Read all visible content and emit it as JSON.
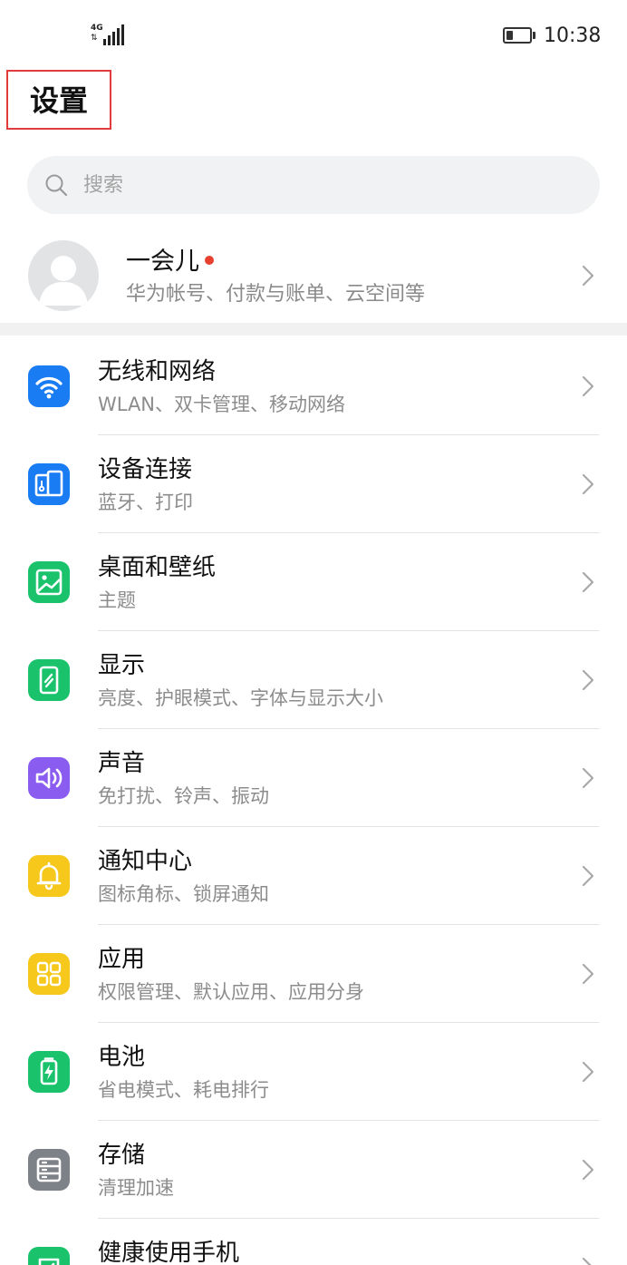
{
  "status_bar": {
    "network": "4G",
    "time": "10:38",
    "battery_level": 0.3
  },
  "header": {
    "title": "设置"
  },
  "search": {
    "placeholder": "搜索",
    "value": ""
  },
  "account": {
    "name": "一会儿",
    "subtitle": "华为帐号、付款与账单、云空间等",
    "has_notification": true
  },
  "colors": {
    "highlight_border": "#e33b3b",
    "notification_dot": "#e8402f",
    "blue": "#1a7cf2",
    "green": "#19c26b",
    "purple": "#8a5cf0",
    "yellow": "#f6c81c",
    "gray": "#7d8188"
  },
  "menu": {
    "items": [
      {
        "title": "无线和网络",
        "subtitle": "WLAN、双卡管理、移动网络",
        "icon": "wifi-icon",
        "color": "#1a7cf2"
      },
      {
        "title": "设备连接",
        "subtitle": "蓝牙、打印",
        "icon": "device-connection-icon",
        "color": "#1a7cf2"
      },
      {
        "title": "桌面和壁纸",
        "subtitle": "主题",
        "icon": "wallpaper-icon",
        "color": "#19c26b"
      },
      {
        "title": "显示",
        "subtitle": "亮度、护眼模式、字体与显示大小",
        "icon": "display-icon",
        "color": "#19c26b"
      },
      {
        "title": "声音",
        "subtitle": "免打扰、铃声、振动",
        "icon": "sound-icon",
        "color": "#8a5cf0"
      },
      {
        "title": "通知中心",
        "subtitle": "图标角标、锁屏通知",
        "icon": "bell-icon",
        "color": "#f6c81c"
      },
      {
        "title": "应用",
        "subtitle": "权限管理、默认应用、应用分身",
        "icon": "apps-icon",
        "color": "#f6c81c"
      },
      {
        "title": "电池",
        "subtitle": "省电模式、耗电排行",
        "icon": "battery-icon",
        "color": "#19c26b"
      },
      {
        "title": "存储",
        "subtitle": "清理加速",
        "icon": "storage-icon",
        "color": "#7d8188"
      },
      {
        "title": "健康使用手机",
        "subtitle": "",
        "icon": "health-icon",
        "color": "#19c26b"
      }
    ]
  }
}
